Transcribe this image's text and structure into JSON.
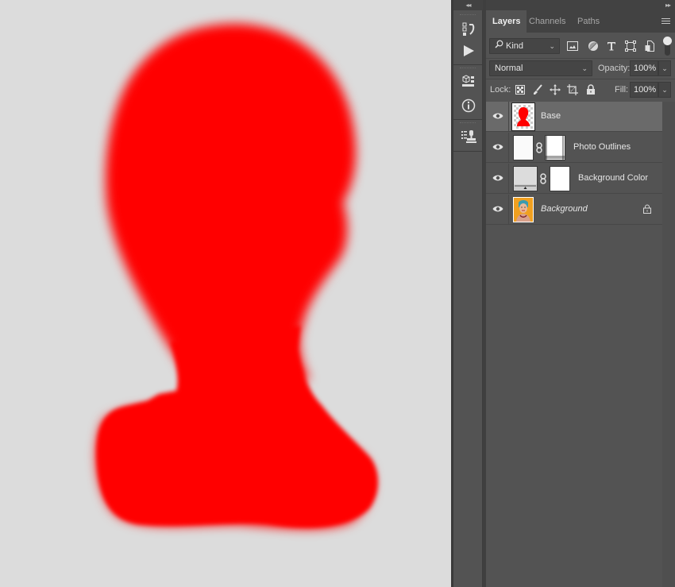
{
  "canvas": {
    "background_color": "#dcdcdc",
    "silhouette_color": "#ff0000",
    "description": "red blurred head-and-shoulders silhouette"
  },
  "tool_strip": {
    "collapse_label": "◂◂",
    "tools": [
      {
        "name": "history-icon"
      },
      {
        "name": "actions-play-icon"
      },
      {
        "name": "properties-3d-icon"
      },
      {
        "name": "info-icon"
      },
      {
        "name": "clone-source-icon"
      }
    ]
  },
  "panel": {
    "expand_label": "▸▸",
    "tabs": [
      {
        "label": "Layers",
        "active": true
      },
      {
        "label": "Channels",
        "active": false
      },
      {
        "label": "Paths",
        "active": false
      }
    ],
    "filter": {
      "kind_label": "Kind",
      "icons": [
        "pixel-filter-icon",
        "adjustment-filter-icon",
        "type-filter-icon",
        "shape-filter-icon",
        "smart-object-filter-icon"
      ]
    },
    "blend_mode": "Normal",
    "opacity_label": "Opacity:",
    "opacity_value": "100%",
    "lock_label": "Lock:",
    "lock_icons": [
      "lock-transparent-pixels-icon",
      "lock-image-pixels-icon",
      "lock-position-icon",
      "lock-artboard-icon",
      "lock-all-icon"
    ],
    "fill_label": "Fill:",
    "fill_value": "100%",
    "chevron": "⌄",
    "layers": [
      {
        "name": "Base",
        "visible": true,
        "selected": true,
        "italic": false,
        "thumb": "red-silhouette",
        "mask": false,
        "locked": false
      },
      {
        "name": "Photo Outlines",
        "visible": true,
        "selected": false,
        "italic": false,
        "thumb": "white",
        "mask": true,
        "locked": false
      },
      {
        "name": "Background Color",
        "visible": true,
        "selected": false,
        "italic": false,
        "thumb": "solid-color-fill",
        "mask": true,
        "locked": false
      },
      {
        "name": "Background",
        "visible": true,
        "selected": false,
        "italic": true,
        "thumb": "portrait-photo",
        "mask": false,
        "locked": true
      }
    ]
  }
}
